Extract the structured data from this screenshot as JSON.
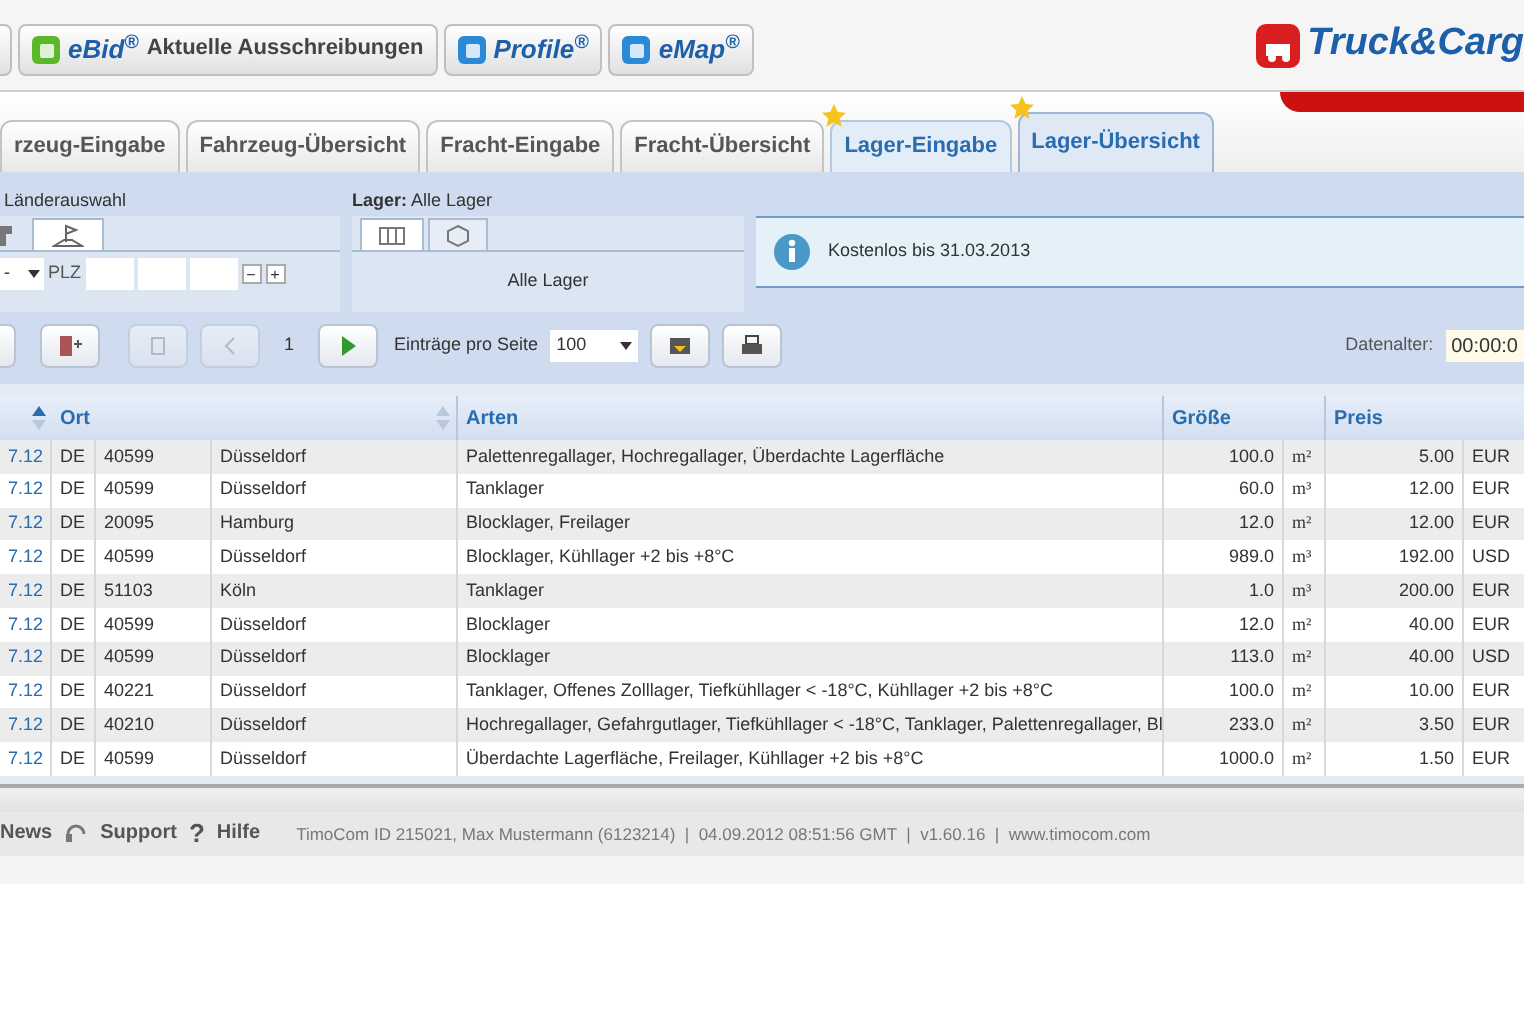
{
  "top_buttons": [
    {
      "kind": "partial"
    },
    {
      "kind": "ebid",
      "label": "eBid$^{®}$",
      "text": "Aktuelle Ausschreibungen"
    },
    {
      "kind": "profile",
      "label": "Profile$^{®}$"
    },
    {
      "kind": "emap",
      "label": "eMap$^{®}$"
    }
  ],
  "logo": {
    "text": "Truck&Carg"
  },
  "tabs": [
    {
      "label": "rzeug-Eingabe",
      "selected": false,
      "starred": false
    },
    {
      "label": "Fahrzeug-Übersicht",
      "selected": false,
      "starred": false
    },
    {
      "label": "Fracht-Eingabe",
      "selected": false,
      "starred": false
    },
    {
      "label": "Fracht-Übersicht",
      "selected": false,
      "starred": false
    },
    {
      "label": "Lager-Eingabe",
      "selected": false,
      "starred": true
    },
    {
      "label": "Lager-Übersicht",
      "selected": true,
      "starred": true
    }
  ],
  "filter": {
    "country_label": "Länderauswahl",
    "country_select": "-",
    "plz_label": "PLZ",
    "minus": "−",
    "plus": "+",
    "lager_label": "**Lager:** Alle Lager",
    "lager_value": "Alle Lager",
    "info": "Kostenlos bis 31.03.2013"
  },
  "toolbar": {
    "page": "1",
    "per_page_label": "Einträge pro Seite",
    "per_page": "100",
    "age_label": "Datenalter:",
    "age_value": "00:00:0"
  },
  "table": {
    "columns": [
      "",
      "Ort",
      "",
      "",
      "Arten",
      "Größe",
      "",
      "Preis",
      ""
    ],
    "rows": [
      [
        "7.12",
        "DE",
        "40599",
        "Düsseldorf",
        "Palettenregallager, Hochregallager, Überdachte Lagerfläche",
        "100.0",
        "m²",
        "5.00",
        "EUR"
      ],
      [
        "7.12",
        "DE",
        "40599",
        "Düsseldorf",
        "Tanklager",
        "60.0",
        "m³",
        "12.00",
        "EUR"
      ],
      [
        "7.12",
        "DE",
        "20095",
        "Hamburg",
        "Blocklager, Freilager",
        "12.0",
        "m²",
        "12.00",
        "EUR"
      ],
      [
        "7.12",
        "DE",
        "40599",
        "Düsseldorf",
        "Blocklager, Kühllager +2 bis +8°C",
        "989.0",
        "m³",
        "192.00",
        "USD"
      ],
      [
        "7.12",
        "DE",
        "51103",
        "Köln",
        "Tanklager",
        "1.0",
        "m³",
        "200.00",
        "EUR"
      ],
      [
        "7.12",
        "DE",
        "40599",
        "Düsseldorf",
        "Blocklager",
        "12.0",
        "m²",
        "40.00",
        "EUR"
      ],
      [
        "7.12",
        "DE",
        "40599",
        "Düsseldorf",
        "Blocklager",
        "113.0",
        "m²",
        "40.00",
        "USD"
      ],
      [
        "7.12",
        "DE",
        "40221",
        "Düsseldorf",
        "Tanklager, Offenes Zolllager, Tiefkühllager < -18°C, Kühllager +2 bis +8°C",
        "100.0",
        "m²",
        "10.00",
        "EUR"
      ],
      [
        "7.12",
        "DE",
        "40210",
        "Düsseldorf",
        "Hochregallager, Gefahrgutlager, Tiefkühllager < -18°C, Tanklager, Palettenregallager, Bl",
        "233.0",
        "m²",
        "3.50",
        "EUR"
      ],
      [
        "7.12",
        "DE",
        "40599",
        "Düsseldorf",
        "Überdachte Lagerfläche, Freilager, Kühllager +2 bis +8°C",
        "1000.0",
        "m²",
        "1.50",
        "EUR"
      ]
    ]
  },
  "footer": {
    "links": [
      "News",
      "Support",
      "Hilfe"
    ],
    "help_icon": "?",
    "info": "TimoCom ID 215021, Max Mustermann (6123214)  |  04.09.2012 08:51:56 GMT  |  v1.60.16  |  www.timocom.com"
  }
}
